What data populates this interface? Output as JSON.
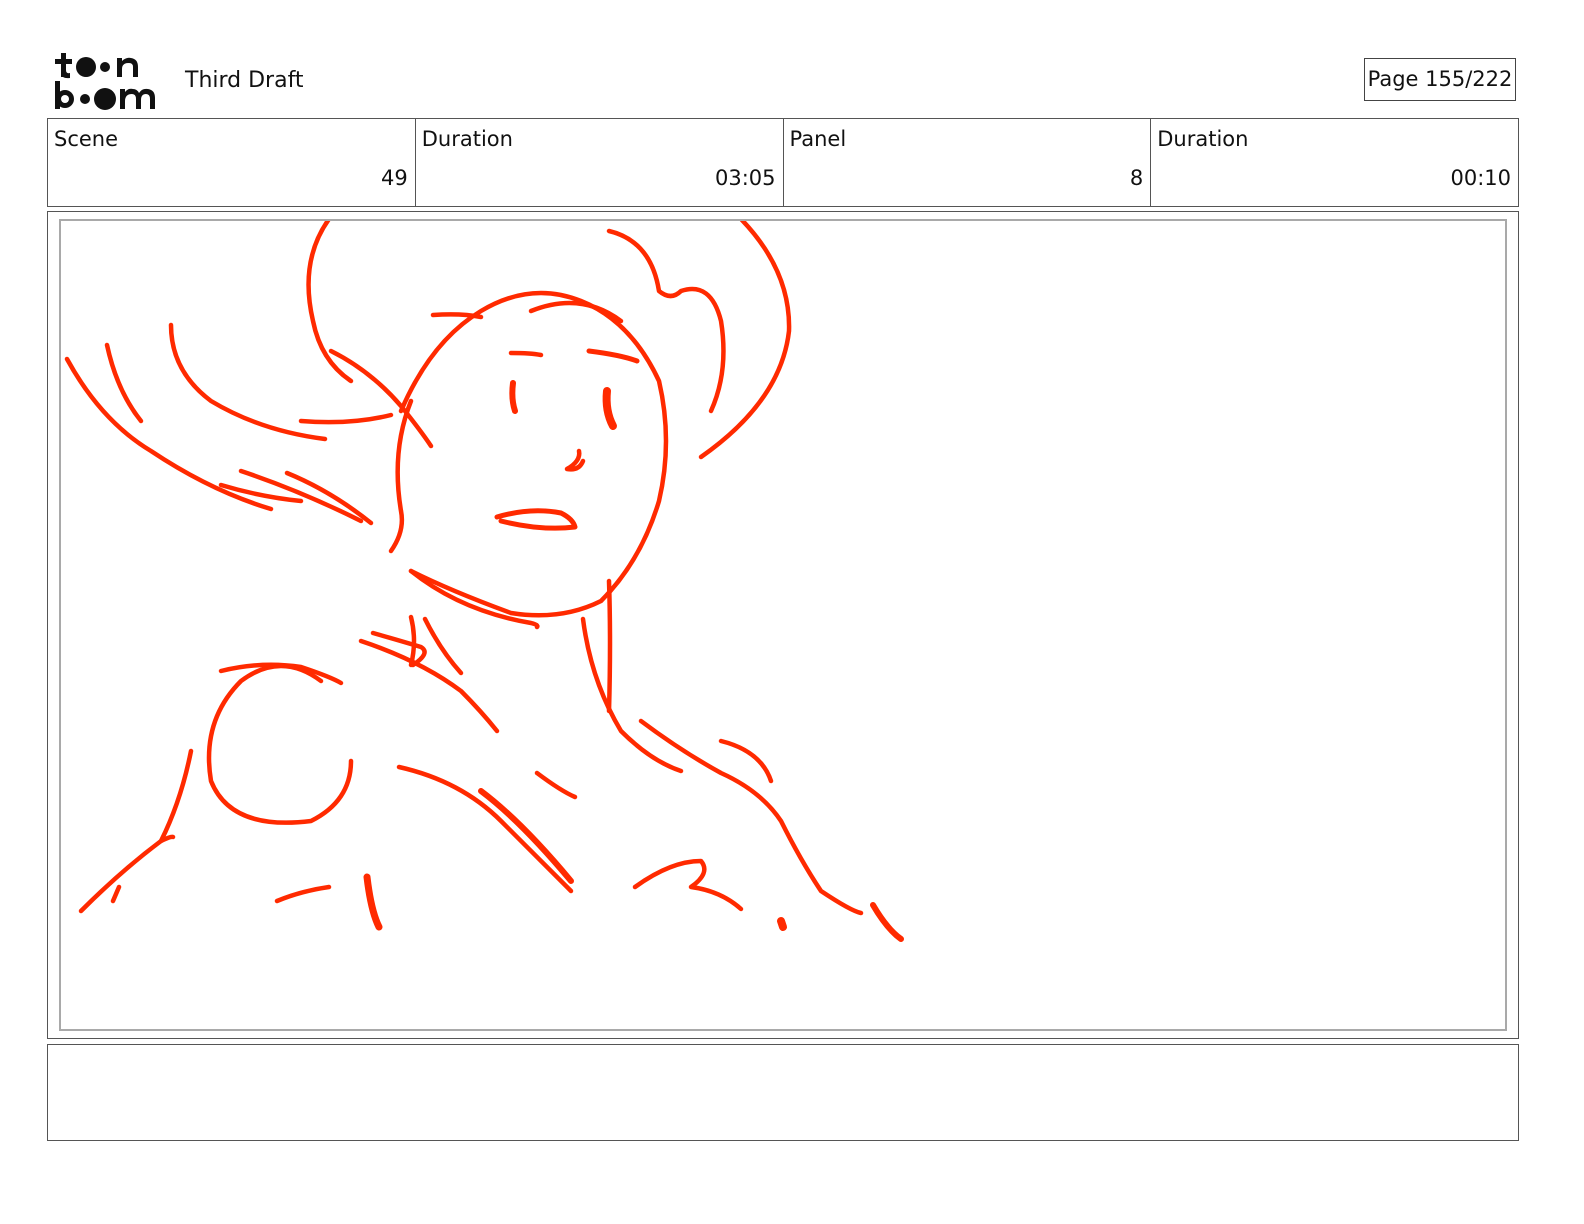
{
  "header": {
    "logo_text": "toon boom",
    "title": "Third Draft",
    "page_label": "Page 155/222"
  },
  "info": {
    "scene_label": "Scene",
    "scene_value": "49",
    "scene_duration_label": "Duration",
    "scene_duration_value": "03:05",
    "panel_label": "Panel",
    "panel_value": "8",
    "panel_duration_label": "Duration",
    "panel_duration_value": "00:10"
  },
  "panel": {
    "sketch_color": "#ff2a00",
    "subject": "red rough sketch of a character looking up over their shoulder"
  },
  "notes": {
    "text": ""
  }
}
